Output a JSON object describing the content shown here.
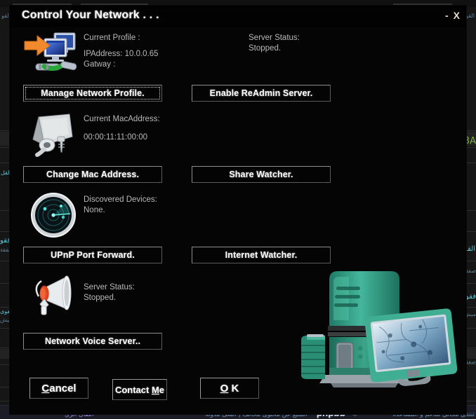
{
  "window": {
    "title": "Control Your Network . . .",
    "minimize_label": "-",
    "close_label": "X"
  },
  "sections": [
    {
      "icon": "network-profile-icon",
      "labels": [
        "Current Profile :",
        "IPAddress: 10.0.0.65",
        "Gatway :"
      ],
      "right_labels": [
        "Server Status:",
        "Stopped."
      ],
      "left_button": "Manage Network Profile.",
      "right_button": "Enable ReAdmin Server.",
      "left_button_focused": true
    },
    {
      "icon": "mac-address-icon",
      "labels": [
        "Current MacAddress:",
        "00:00:11:11:00:00"
      ],
      "right_labels": [],
      "left_button": "Change Mac Address.",
      "right_button": "Share Watcher.",
      "left_button_focused": false
    },
    {
      "icon": "radar-discovery-icon",
      "labels": [
        "Discovered Devices:",
        "None."
      ],
      "right_labels": [],
      "left_button": "UPnP Port Forward.",
      "right_button": "Internet Watcher.",
      "left_button_focused": false
    },
    {
      "icon": "megaphone-voice-icon",
      "labels": [
        "Server Status:",
        "Stopped."
      ],
      "right_labels": [],
      "left_button": "Network Voice Server..",
      "right_button": "",
      "left_button_focused": false
    }
  ],
  "footer_buttons": {
    "cancel": {
      "pre": "",
      "key": "C",
      "post": "ancel"
    },
    "contact": {
      "pre": "Contact ",
      "key": "M",
      "post": "e"
    },
    "ok": {
      "pre": "",
      "key": "O",
      "post": " K"
    }
  },
  "artwork": {
    "server_illustration": "server-tower-monitor-illustration"
  },
  "background": {
    "footer_line_rtl": "تنتدى مجاني للدعم و المساعدة",
    "footer_copyright": "©",
    "footer_brand": "phpbb",
    "footer_links": "التبليغ عن محتوى مخالف | انشئ مدونة",
    "footer_left": "انتقال الري",
    "side_snippets": [
      "القو",
      "القوى",
      "3A",
      "القل",
      "صفقة",
      "فقو",
      "ميش"
    ]
  },
  "colors": {
    "dialog_bg": "#050505",
    "button_border": "#8e8e8e",
    "label_text": "#b9b9b9",
    "title_text": "#fdfdfd",
    "win_button": "#e6dcc6",
    "server_teal": "#2e9d87",
    "accent_orange": "#e8802a"
  }
}
